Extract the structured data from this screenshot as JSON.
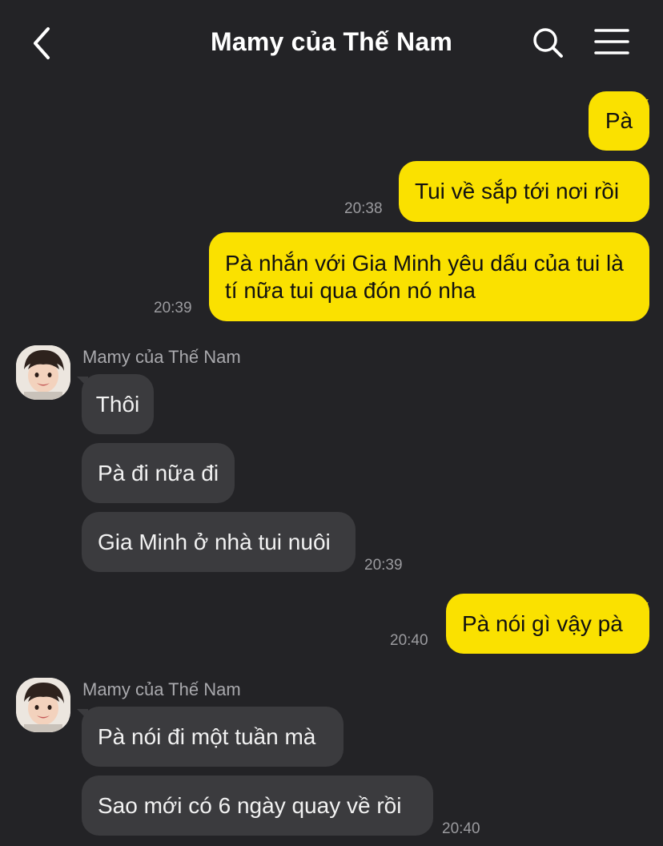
{
  "header": {
    "title": "Mamy của Thế Nam",
    "back_icon": "chevron-left-icon",
    "search_icon": "search-icon",
    "menu_icon": "hamburger-menu-icon"
  },
  "colors": {
    "background": "#232326",
    "my_bubble": "#fae100",
    "their_bubble": "#3b3b3e"
  },
  "messages": [
    {
      "sender": "me",
      "text": "Pà"
    },
    {
      "sender": "me",
      "text": "Tui về sắp tới nơi rồi",
      "time": "20:38"
    },
    {
      "sender": "me",
      "text": "Pà nhắn với Gia Minh yêu dấu của tui là tí nữa tui qua đón nó nha",
      "time": "20:39"
    },
    {
      "sender_name": "Mamy của Thế Nam",
      "text": "Thôi"
    },
    {
      "text": "Pà đi nữa đi"
    },
    {
      "text": "Gia Minh ở nhà tui nuôi",
      "time": "20:39"
    },
    {
      "sender": "me",
      "text": "Pà nói gì vậy pà",
      "time": "20:40"
    },
    {
      "sender_name": "Mamy của Thế Nam",
      "text": "Pà nói đi một tuần mà"
    },
    {
      "text": "Sao mới có 6 ngày quay về rồi",
      "time": "20:40"
    }
  ]
}
